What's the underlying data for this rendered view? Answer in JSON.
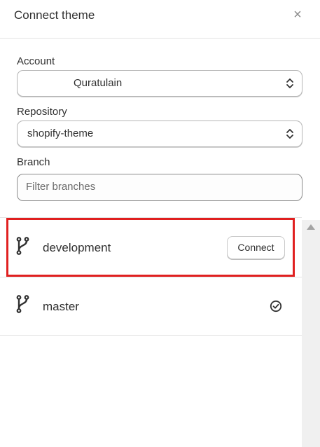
{
  "header": {
    "title": "Connect theme",
    "close_glyph": "×"
  },
  "account": {
    "label": "Account",
    "value": "Quratulain"
  },
  "repository": {
    "label": "Repository",
    "value": "shopify-theme"
  },
  "branch": {
    "label": "Branch",
    "placeholder": "Filter branches"
  },
  "branches": [
    {
      "name": "development",
      "action_label": "Connect"
    },
    {
      "name": "master",
      "status": "connected-check-icon"
    }
  ],
  "colors": {
    "highlight": "#e02020",
    "text": "#303030"
  }
}
